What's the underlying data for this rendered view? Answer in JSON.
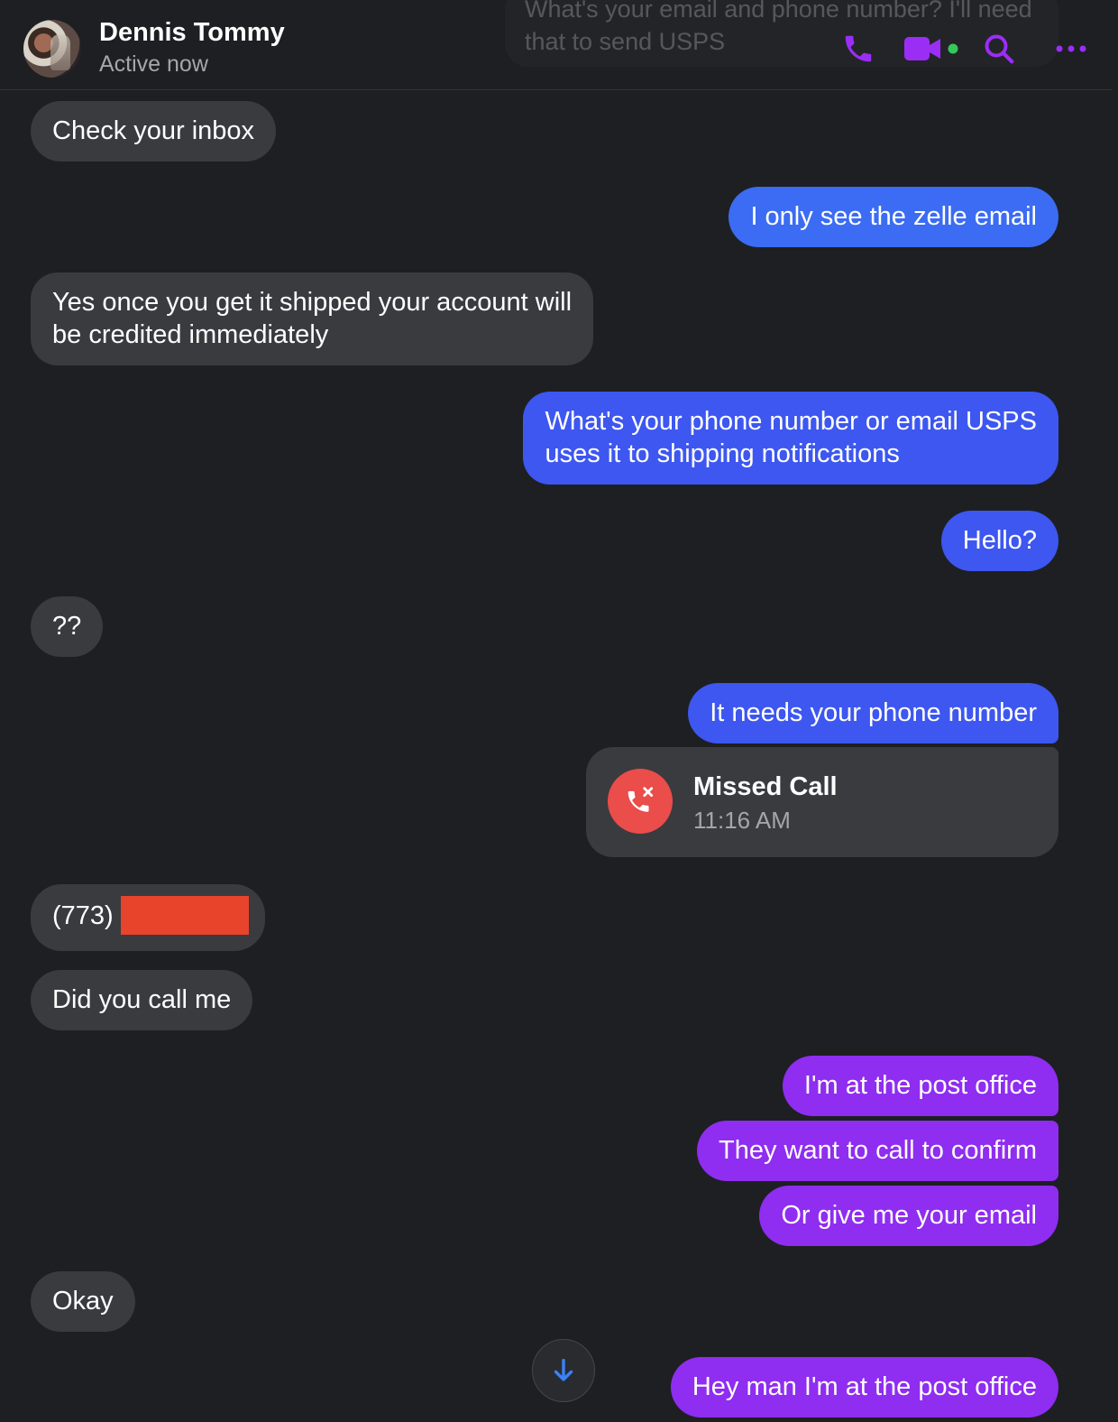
{
  "header": {
    "contact_name": "Dennis Tommy",
    "status": "Active now",
    "ghost_text": "What's your email and phone number? I'll need that to send USPS",
    "icons": [
      "phone-icon",
      "video-icon",
      "search-icon",
      "more-icon"
    ],
    "accent_color": "#9b2ef5"
  },
  "messages": {
    "m1": "Check your inbox",
    "m2": "I only see the zelle email",
    "m3_l1": "Yes  once you  get it shipped your account will",
    "m3_l2": "be credited immediately",
    "m4_l1": "What's your phone number or email USPS",
    "m4_l2": "uses it to shipping notifications",
    "m5": "Hello?",
    "m6": "??",
    "m7": "It needs your phone number",
    "m8": "(773)",
    "m9": "Did you call me",
    "m10": "I'm at the post office",
    "m11": "They want to call to confirm",
    "m12": "Or give me your email",
    "m13": "Okay",
    "m14": "Hey man I'm at the post office"
  },
  "missed_call": {
    "title": "Missed Call",
    "time": "11:16 AM",
    "icon": "missed-call-icon"
  },
  "colors": {
    "background": "#1e1f22",
    "incoming_bubble": "#3a3b3f",
    "outgoing_blue": "#3d57f0",
    "outgoing_purple": "#8f2df0",
    "missed_call_red": "#ea4d4a",
    "redaction": "#e8432b"
  }
}
